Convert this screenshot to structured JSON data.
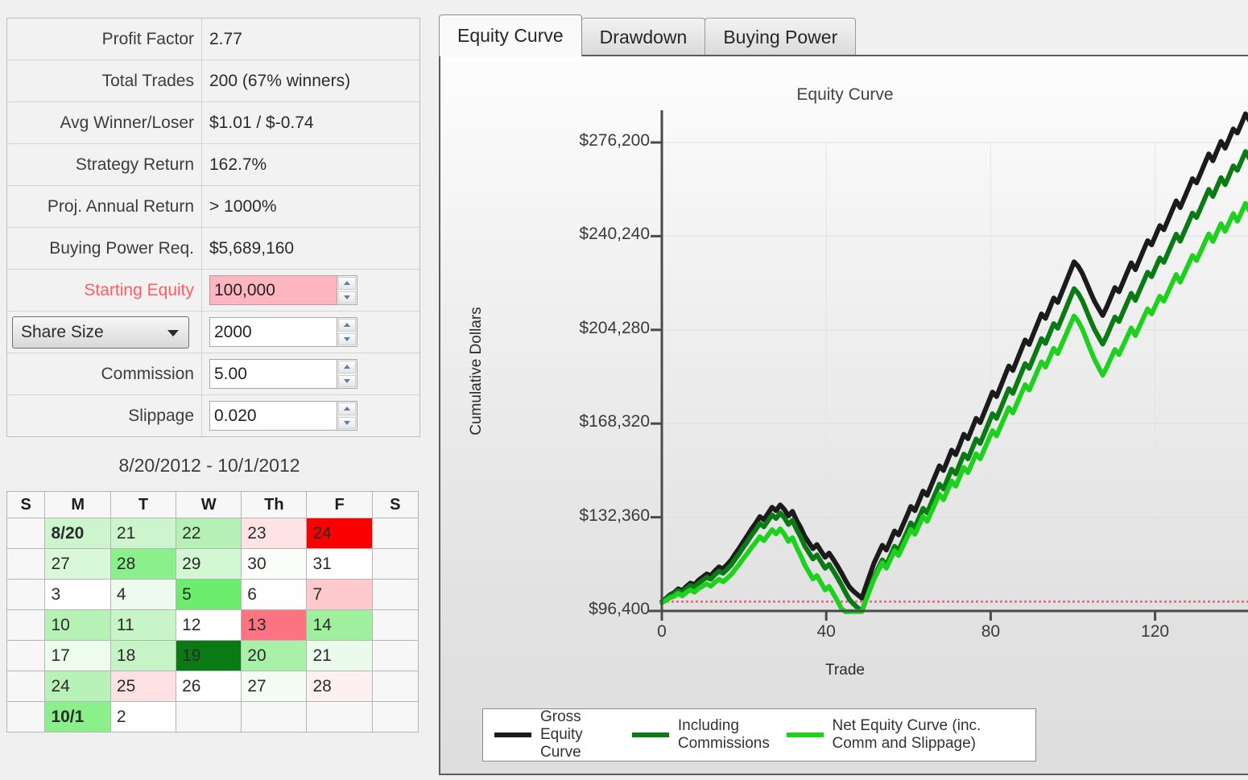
{
  "stats": {
    "rows": [
      {
        "label": "Profit Factor",
        "value": "2.77",
        "type": "text"
      },
      {
        "label": "Total Trades",
        "value": "200 (67% winners)",
        "type": "text"
      },
      {
        "label": "Avg Winner/Loser",
        "value": "$1.01 / $-0.74",
        "type": "text"
      },
      {
        "label": "Strategy Return",
        "value": "162.7%",
        "type": "text"
      },
      {
        "label": "Proj. Annual Return",
        "value": "> 1000%",
        "type": "text"
      },
      {
        "label": "Buying Power Req.",
        "value": "$5,689,160",
        "type": "text"
      },
      {
        "label": "Starting Equity",
        "value": "100,000",
        "type": "spinner",
        "accent": true
      },
      {
        "label": "Share Size",
        "value": "2000",
        "type": "combo-spinner"
      },
      {
        "label": "Commission",
        "value": "5.00",
        "type": "spinner"
      },
      {
        "label": "Slippage",
        "value": "0.020",
        "type": "spinner"
      }
    ],
    "accent_color": "#ff5b60",
    "starting_equity_field_color": "#ffb6c1"
  },
  "calendar": {
    "title": "8/20/2012 - 10/1/2012",
    "headers": [
      "S",
      "M",
      "T",
      "W",
      "Th",
      "F",
      "S"
    ],
    "weeks": [
      [
        {
          "text": "",
          "color": "#f7f7f7",
          "bold": false
        },
        {
          "text": "8/20",
          "color": "#cdf5cd",
          "bold": true
        },
        {
          "text": "21",
          "color": "#cdf5cd",
          "bold": false
        },
        {
          "text": "22",
          "color": "#b5f1b5",
          "bold": false
        },
        {
          "text": "23",
          "color": "#fde3e3",
          "bold": false
        },
        {
          "text": "24",
          "color": "#fb0000",
          "bold": false
        },
        {
          "text": "",
          "color": "#f7f7f7",
          "bold": false
        }
      ],
      [
        {
          "text": "",
          "color": "#f7f7f7",
          "bold": false
        },
        {
          "text": "27",
          "color": "#d9f8d9",
          "bold": false
        },
        {
          "text": "28",
          "color": "#8bef8b",
          "bold": false
        },
        {
          "text": "29",
          "color": "#d2f7d2",
          "bold": false
        },
        {
          "text": "30",
          "color": "#fbfdfb",
          "bold": false
        },
        {
          "text": "31",
          "color": "#ffffff",
          "bold": false
        },
        {
          "text": "",
          "color": "#f7f7f7",
          "bold": false
        }
      ],
      [
        {
          "text": "",
          "color": "#f7f7f7",
          "bold": false
        },
        {
          "text": "3",
          "color": "#ffffff",
          "bold": false
        },
        {
          "text": "4",
          "color": "#eefaee",
          "bold": false
        },
        {
          "text": "5",
          "color": "#6ded6d",
          "bold": false
        },
        {
          "text": "6",
          "color": "#fdfefd",
          "bold": false
        },
        {
          "text": "7",
          "color": "#ffc9cd",
          "bold": false
        },
        {
          "text": "",
          "color": "#f7f7f7",
          "bold": false
        }
      ],
      [
        {
          "text": "",
          "color": "#f7f7f7",
          "bold": false
        },
        {
          "text": "10",
          "color": "#b6f2b6",
          "bold": false
        },
        {
          "text": "11",
          "color": "#c8f5c8",
          "bold": false
        },
        {
          "text": "12",
          "color": "#ffffff",
          "bold": false
        },
        {
          "text": "13",
          "color": "#fb7480",
          "bold": false
        },
        {
          "text": "14",
          "color": "#9ef09e",
          "bold": false
        },
        {
          "text": "",
          "color": "#f7f7f7",
          "bold": false
        }
      ],
      [
        {
          "text": "",
          "color": "#f7f7f7",
          "bold": false
        },
        {
          "text": "17",
          "color": "#edfced",
          "bold": false
        },
        {
          "text": "18",
          "color": "#c7f4c7",
          "bold": false
        },
        {
          "text": "19",
          "color": "#0a7a14",
          "bold": false
        },
        {
          "text": "20",
          "color": "#a9f1a9",
          "bold": false
        },
        {
          "text": "21",
          "color": "#ebfbeb",
          "bold": false
        },
        {
          "text": "",
          "color": "#f7f7f7",
          "bold": false
        }
      ],
      [
        {
          "text": "",
          "color": "#f7f7f7",
          "bold": false
        },
        {
          "text": "24",
          "color": "#b8f2b8",
          "bold": false
        },
        {
          "text": "25",
          "color": "#fde0e2",
          "bold": false
        },
        {
          "text": "26",
          "color": "#ffffff",
          "bold": false
        },
        {
          "text": "27",
          "color": "#f3fcf3",
          "bold": false
        },
        {
          "text": "28",
          "color": "#fdf0f1",
          "bold": false
        },
        {
          "text": "",
          "color": "#f7f7f7",
          "bold": false
        }
      ],
      [
        {
          "text": "",
          "color": "#f7f7f7",
          "bold": false
        },
        {
          "text": "10/1",
          "color": "#8bef8b",
          "bold": true
        },
        {
          "text": "2",
          "color": "#ffffff",
          "bold": false
        },
        {
          "text": "",
          "color": "#f7f7f7",
          "bold": false
        },
        {
          "text": "",
          "color": "#f7f7f7",
          "bold": false
        },
        {
          "text": "",
          "color": "#f7f7f7",
          "bold": false
        },
        {
          "text": "",
          "color": "#f7f7f7",
          "bold": false
        }
      ]
    ]
  },
  "tabs": [
    {
      "label": "Equity Curve",
      "active": true
    },
    {
      "label": "Drawdown",
      "active": false
    },
    {
      "label": "Buying Power",
      "active": false
    }
  ],
  "chart_data": {
    "type": "line",
    "title": "Equity Curve",
    "xlabel": "Trade",
    "ylabel": "Cumulative Dollars",
    "grid": true,
    "legend_position": "bottom-left",
    "xlim": [
      0,
      143
    ],
    "ylim": [
      96400,
      276200
    ],
    "yticks": [
      96400,
      132360,
      168320,
      204280,
      240240,
      276200
    ],
    "ytick_labels": [
      "$96,400",
      "$132,360",
      "$168,320",
      "$204,280",
      "$240,240",
      "$276,200"
    ],
    "xticks": [
      0,
      40,
      80,
      120
    ],
    "xtick_labels": [
      "0",
      "40",
      "80",
      "120"
    ],
    "reference_line": {
      "value": 100000,
      "color": "#e8505b",
      "style": "dotted"
    },
    "series": [
      {
        "name": "Gross Equity Curve",
        "color": "#1b1b1b",
        "values": [
          100000,
          101200,
          102600,
          103400,
          104900,
          104200,
          105800,
          107100,
          106500,
          108200,
          109400,
          110600,
          110000,
          111800,
          113300,
          112600,
          114200,
          116000,
          118400,
          120600,
          123100,
          125400,
          127900,
          130100,
          132600,
          131400,
          133800,
          136200,
          134900,
          137100,
          135400,
          132900,
          134600,
          131200,
          128400,
          125100,
          122700,
          120300,
          121900,
          119400,
          117000,
          118600,
          116200,
          113700,
          111000,
          108100,
          105500,
          103900,
          102600,
          101300,
          106000,
          110400,
          114800,
          118200,
          121600,
          119800,
          123400,
          127100,
          125600,
          129200,
          132800,
          136500,
          134900,
          138600,
          142400,
          140800,
          144600,
          148400,
          152100,
          150300,
          154200,
          158100,
          156400,
          160300,
          164200,
          162500,
          166400,
          170300,
          168700,
          172600,
          176500,
          180400,
          178700,
          182600,
          186500,
          190400,
          188700,
          192600,
          196500,
          200400,
          198700,
          202600,
          206500,
          210400,
          208700,
          212600,
          216500,
          214800,
          218700,
          222600,
          226500,
          230400,
          228700,
          226000,
          222400,
          218700,
          215200,
          212500,
          209800,
          213100,
          216800,
          220500,
          218900,
          222600,
          226300,
          230000,
          227400,
          231100,
          234800,
          238500,
          236900,
          240600,
          244300,
          242700,
          246400,
          250100,
          253800,
          251200,
          254900,
          258600,
          262300,
          260700,
          264400,
          268100,
          271800,
          269200,
          272900,
          276600,
          274000,
          277700,
          281400,
          279800,
          283500,
          287200,
          284600
        ]
      },
      {
        "name": "Including Commissions",
        "color": "#0a7a14",
        "values": [
          99800,
          100900,
          102200,
          102900,
          104300,
          103500,
          105000,
          106200,
          105500,
          107100,
          108200,
          109300,
          108600,
          110300,
          111700,
          110900,
          112400,
          114100,
          116400,
          118500,
          120900,
          123100,
          125500,
          127600,
          130000,
          128700,
          131000,
          133300,
          131900,
          134000,
          132200,
          129600,
          131200,
          127700,
          124800,
          121400,
          118900,
          116400,
          117900,
          115300,
          112800,
          114300,
          111800,
          109200,
          106400,
          103400,
          100700,
          99000,
          97600,
          96200,
          100800,
          105100,
          109400,
          112700,
          116000,
          114100,
          117600,
          121200,
          119600,
          123100,
          126600,
          130200,
          128500,
          132100,
          135800,
          134100,
          137800,
          141500,
          145100,
          143200,
          147000,
          150800,
          149000,
          152800,
          156600,
          154800,
          158600,
          162400,
          160700,
          164500,
          168300,
          172100,
          170300,
          174100,
          177900,
          181700,
          179900,
          183700,
          187500,
          191300,
          189500,
          193300,
          197100,
          200900,
          199100,
          202900,
          206700,
          204900,
          208700,
          212500,
          216300,
          220100,
          218300,
          215500,
          211800,
          208000,
          204400,
          201600,
          198800,
          202000,
          205600,
          209200,
          207500,
          211100,
          214700,
          218300,
          215600,
          219200,
          222800,
          226400,
          224700,
          228300,
          231900,
          230200,
          233800,
          237400,
          241000,
          238300,
          241900,
          245500,
          249100,
          247400,
          251000,
          254600,
          258200,
          255500,
          259100,
          262700,
          260000,
          263600,
          267200,
          265500,
          269100,
          272700,
          270000
        ]
      },
      {
        "name": "Net Equity Curve (inc. Comm and Slippage)",
        "color": "#1fd11f",
        "values": [
          99600,
          100400,
          101500,
          102000,
          103200,
          102200,
          103500,
          104500,
          103600,
          105000,
          105900,
          106800,
          105900,
          107400,
          108600,
          107600,
          108900,
          110400,
          112500,
          114400,
          116600,
          118600,
          120800,
          122700,
          124900,
          123400,
          125500,
          127600,
          126000,
          127900,
          125900,
          123100,
          124500,
          120800,
          117700,
          114100,
          111400,
          108700,
          110000,
          107200,
          104500,
          105800,
          103100,
          100300,
          97300,
          96100,
          96150,
          96180,
          96200,
          96150,
          100500,
          104600,
          108700,
          111800,
          114900,
          112800,
          116100,
          119500,
          117700,
          121000,
          124300,
          127700,
          125800,
          129200,
          132700,
          130800,
          134300,
          137800,
          141200,
          139100,
          142700,
          146300,
          144300,
          147900,
          151500,
          149500,
          153100,
          156700,
          154800,
          158400,
          162000,
          165600,
          163600,
          167200,
          170800,
          174400,
          172400,
          176000,
          179600,
          183200,
          181200,
          184800,
          188400,
          192000,
          190000,
          193600,
          197200,
          195200,
          198800,
          202400,
          206000,
          209600,
          207600,
          204600,
          200700,
          196700,
          192900,
          189900,
          186900,
          189900,
          193300,
          196700,
          194800,
          198200,
          201600,
          205000,
          202100,
          205500,
          208900,
          212300,
          210400,
          213800,
          217200,
          215300,
          218700,
          222100,
          225500,
          222600,
          226000,
          229400,
          232800,
          230900,
          234300,
          237700,
          241100,
          238200,
          241600,
          245000,
          242100,
          245500,
          248900,
          246000,
          249400,
          252800,
          249900
        ]
      }
    ]
  },
  "legend": {
    "items": [
      {
        "label": "Gross Equity Curve",
        "color": "#1b1b1b"
      },
      {
        "label": "Including Commissions",
        "color": "#0a7a14"
      },
      {
        "label": "Net Equity Curve (inc. Comm and Slippage)",
        "color": "#1fd11f"
      }
    ]
  }
}
